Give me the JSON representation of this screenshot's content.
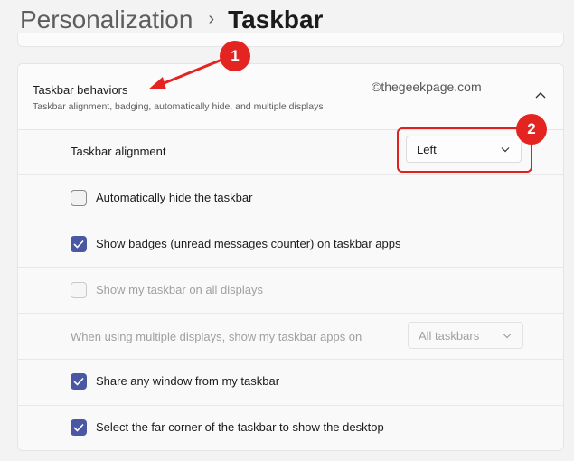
{
  "breadcrumb": {
    "parent": "Personalization",
    "separator": "›",
    "current": "Taskbar"
  },
  "section": {
    "title": "Taskbar behaviors",
    "description": "Taskbar alignment, badging, automatically hide, and multiple displays",
    "expanded": true
  },
  "watermark": "©thegeekpage.com",
  "alignment": {
    "label": "Taskbar alignment",
    "value": "Left"
  },
  "checkboxes": [
    {
      "label": "Automatically hide the taskbar",
      "checked": false,
      "enabled": true
    },
    {
      "label": "Show badges (unread messages counter) on taskbar apps",
      "checked": true,
      "enabled": true
    },
    {
      "label": "Show my taskbar on all displays",
      "checked": false,
      "enabled": false
    }
  ],
  "multi_display": {
    "label": "When using multiple displays, show my taskbar apps on",
    "value": "All taskbars",
    "enabled": false
  },
  "checkboxes2": [
    {
      "label": "Share any window from my taskbar",
      "checked": true,
      "enabled": true
    },
    {
      "label": "Select the far corner of the taskbar to show the desktop",
      "checked": true,
      "enabled": true
    }
  ],
  "annotations": {
    "badge1": "1",
    "badge2": "2"
  },
  "colors": {
    "accent": "#4a57a3",
    "annotation_red": "#e42420"
  }
}
